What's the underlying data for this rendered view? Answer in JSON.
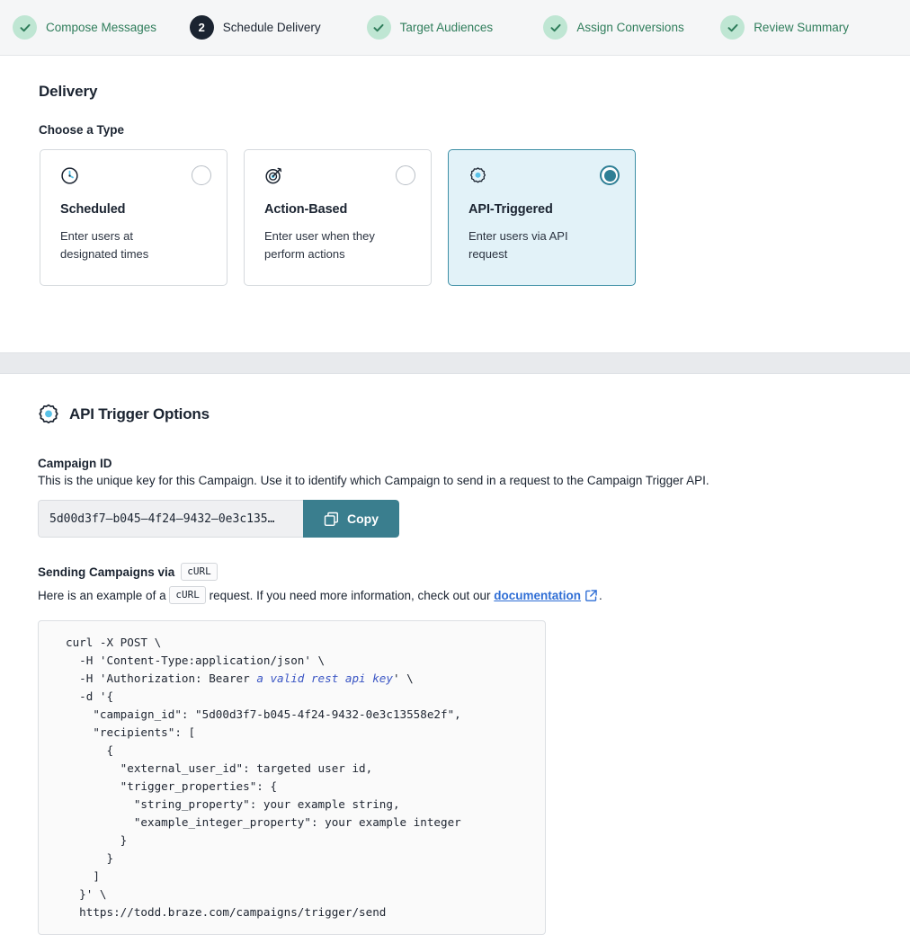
{
  "stepper": {
    "steps": [
      {
        "label": "Compose Messages",
        "state": "done",
        "badge": "check"
      },
      {
        "label": "Schedule Delivery",
        "state": "current",
        "badge": "2"
      },
      {
        "label": "Target Audiences",
        "state": "done",
        "badge": "check"
      },
      {
        "label": "Assign Conversions",
        "state": "done",
        "badge": "check"
      },
      {
        "label": "Review Summary",
        "state": "done",
        "badge": "check"
      }
    ]
  },
  "delivery": {
    "heading": "Delivery",
    "subheading": "Choose a Type",
    "cards": [
      {
        "icon": "clock-icon",
        "title": "Scheduled",
        "desc": "Enter users at designated times",
        "selected": false
      },
      {
        "icon": "target-icon",
        "title": "Action-Based",
        "desc": "Enter user when they perform actions",
        "selected": false
      },
      {
        "icon": "gear-icon",
        "title": "API-Triggered",
        "desc": "Enter users via API request",
        "selected": true
      }
    ]
  },
  "api_options": {
    "heading": "API Trigger Options",
    "campaign_id_label": "Campaign ID",
    "campaign_id_desc": "This is the unique key for this Campaign. Use it to identify which Campaign to send in a request to the Campaign Trigger API.",
    "campaign_id_value": "5d00d3f7–b045–4f24–9432–0e3c135…",
    "copy_label": "Copy",
    "sending_label": "Sending Campaigns via",
    "sending_chip": "cURL",
    "example_prefix": "Here is an example of a",
    "example_chip": "cURL",
    "example_middle": "request. If you need more information, check out our",
    "doc_link": "documentation",
    "example_suffix": ".",
    "code": {
      "line1": "curl -X POST \\",
      "line2": "  -H 'Content-Type:application/json' \\",
      "line3_pre": "  -H 'Authorization: Bearer ",
      "line3_em": "a valid rest api key",
      "line3_post": "' \\",
      "line4": "  -d '{",
      "line5": "    \"campaign_id\": \"5d00d3f7-b045-4f24-9432-0e3c13558e2f\",",
      "line6": "    \"recipients\": [",
      "line7": "      {",
      "line8": "        \"external_user_id\": targeted user id,",
      "line9": "        \"trigger_properties\": {",
      "line10": "          \"string_property\": your example string,",
      "line11": "          \"example_integer_property\": your example integer",
      "line12": "        }",
      "line13": "      }",
      "line14": "    ]",
      "line15": "  }' \\",
      "line16": "  https://todd.braze.com/campaigns/trigger/send"
    }
  },
  "colors": {
    "accent_teal": "#3a7e8e",
    "selected_bg": "#e2f2f8",
    "done_green": "#2f7d5b",
    "done_badge_bg": "#bfe6d3",
    "current_badge_bg": "#1b2431",
    "link_blue": "#2f6ed5"
  }
}
